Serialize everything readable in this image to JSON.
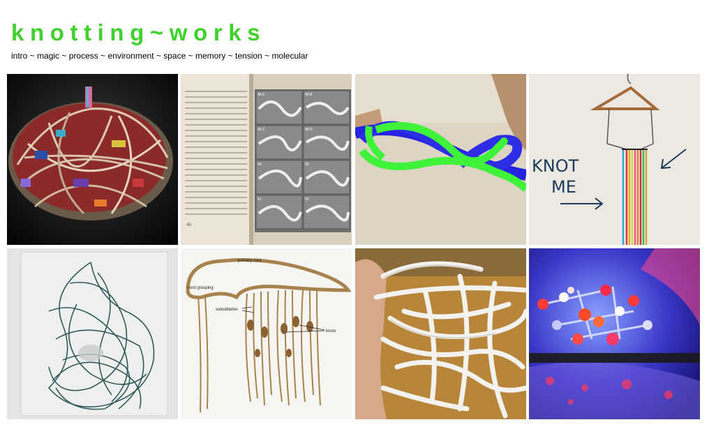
{
  "site": {
    "title": "knotting~works",
    "accent_color": "#3fd12c"
  },
  "nav": {
    "items": [
      "intro",
      "magic",
      "process",
      "environment",
      "space",
      "memory",
      "tension",
      "molecular"
    ],
    "separator": "~"
  },
  "tiles": [
    {
      "id": "knot-sculpture",
      "icon": "photo-knotted-ball"
    },
    {
      "id": "knot-book",
      "icon": "photo-book-diagrams",
      "page_labels": [
        "48 A",
        "48 B",
        "48 C",
        "48 D",
        "49",
        "50",
        "51",
        "52"
      ],
      "page_number": "46"
    },
    {
      "id": "drawn-knot",
      "icon": "photo-drawn-knot-hands"
    },
    {
      "id": "knot-me-wall",
      "icon": "photo-hanger-threads",
      "wall_text": [
        "KNOT",
        "ME"
      ]
    },
    {
      "id": "thread-bag",
      "icon": "photo-tangled-thread"
    },
    {
      "id": "quipu",
      "icon": "photo-quipu",
      "labels": {
        "primary": "primary cord",
        "grouping": "cord grouping",
        "subsidiaries": "subsidiaries",
        "knots": "knots"
      }
    },
    {
      "id": "white-strips",
      "icon": "photo-white-strips"
    },
    {
      "id": "molecule",
      "icon": "photo-molecular-model"
    }
  ]
}
